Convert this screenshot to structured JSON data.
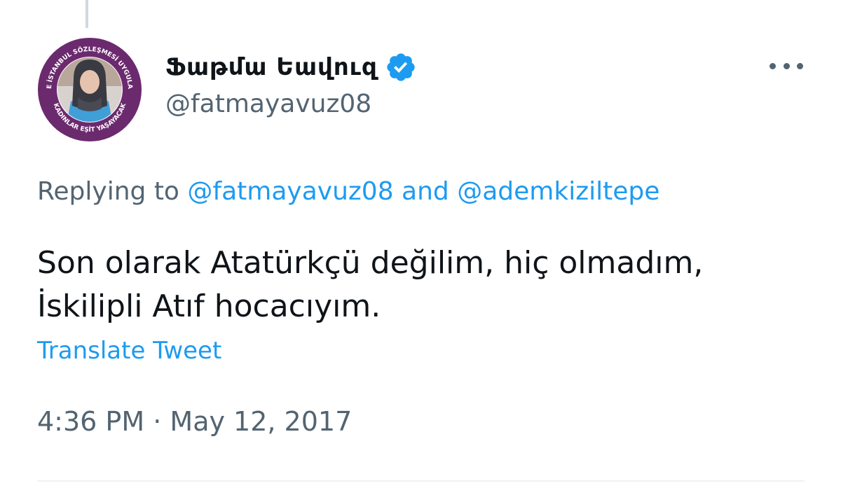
{
  "tweet": {
    "author": {
      "display_name": "Ֆաթմա Եավուզ",
      "handle": "@fatmayavuz08",
      "verified": true,
      "avatar_ring_text": "6284 VE İSTANBUL SÖZLEŞMESİ UYGULANACAK · KADINLAR EŞİT YAŞAYACAK"
    },
    "replying": {
      "prefix": "Replying to",
      "mention_1": "@fatmayavuz08",
      "conjunction": "and",
      "mention_2": "@ademkiziltepe"
    },
    "text_lines": [
      "Son olarak Atatürkçü değilim, hiç olmadım,",
      "İskilipli Atıf hocacıyım."
    ],
    "translate_label": "Translate Tweet",
    "time": "4:36 PM",
    "separator": "·",
    "date": "May 12, 2017"
  },
  "icons": {
    "more": "more-horizontal-icon",
    "verified": "verified-badge-icon"
  },
  "colors": {
    "accent": "#1d9bf0",
    "secondary_text": "#536471",
    "primary_text": "#0f1419",
    "avatar_ring": "#6b2a6e"
  }
}
